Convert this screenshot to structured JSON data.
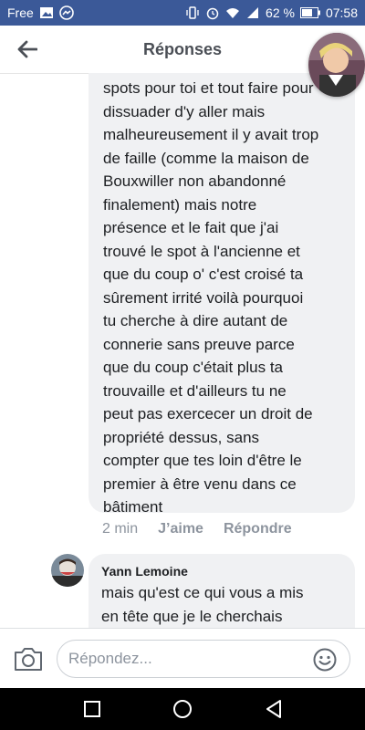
{
  "status_bar": {
    "carrier": "Free",
    "battery": "62 %",
    "time": "07:58",
    "background": "#3b5998"
  },
  "header": {
    "title": "Réponses"
  },
  "comment_long": {
    "text": "spots pour toi et tout faire pour\ndissuader d'y aller mais\nmalheureusement il y avait trop\nde faille (comme la maison de\nBouxwiller non abandonné\nfinalement) mais notre\nprésence et le fait que j'ai\ntrouvé le spot à l'ancienne et\nque du coup o' c'est croisé ta\nsûrement irrité voilà pourquoi\ntu cherche à dire autant de\nconnerie sans preuve parce\nque du coup c'était plus ta\ntrouvaille et d'ailleurs tu ne\npeut pas exercecer un droit de\npropriété dessus, sans\ncompter que tes loin d'être le\npremier à être venu dans ce\nbâtiment",
    "time": "2 min",
    "like_label": "J’aime",
    "reply_label": "Répondre"
  },
  "comment_reply": {
    "author": "Yann Lemoine",
    "text": "mais qu'est ce qui vous a mis\nen tête que je le cherchais"
  },
  "composer": {
    "placeholder": "Répondez..."
  },
  "icons": {
    "back": "arrow-left-icon",
    "camera": "camera-icon",
    "emoji": "smiley-icon",
    "nav_back": "triangle-back-icon",
    "nav_home": "circle-home-icon",
    "nav_recent": "square-recent-icon"
  }
}
